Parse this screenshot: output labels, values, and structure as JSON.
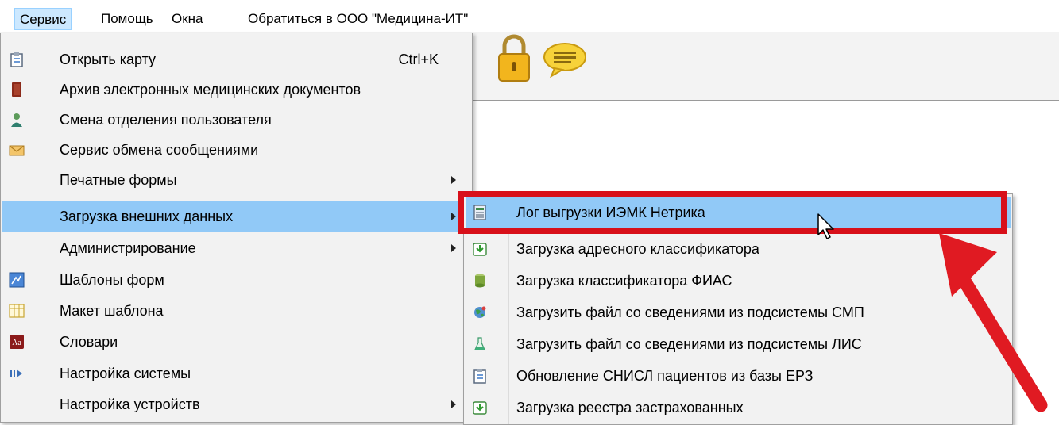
{
  "menubar": {
    "items": [
      "Сервис",
      "Помощь",
      "Окна",
      "Обратиться в ООО \"Медицина-ИТ\""
    ]
  },
  "service_menu": {
    "items": [
      {
        "label": "Открыть карту",
        "shortcut": "Ctrl+K",
        "icon": "clipboard-icon"
      },
      {
        "label": "Архив электронных медицинских документов",
        "icon": "archive-book-icon"
      },
      {
        "label": "Смена отделения пользователя",
        "icon": "doctor-icon"
      },
      {
        "label": "Сервис обмена сообщениями",
        "icon": "envelope-icon"
      },
      {
        "label": "Печатные формы",
        "submenu": true
      },
      {
        "label": "Загрузка внешних данных",
        "submenu": true,
        "highlighted": true
      },
      {
        "label": "Администрирование",
        "submenu": true
      },
      {
        "label": "Шаблоны форм",
        "icon": "template-icon"
      },
      {
        "label": "Макет шаблона",
        "icon": "grid-icon"
      },
      {
        "label": "Словари",
        "icon": "dictionary-icon"
      },
      {
        "label": "Настройка системы",
        "icon": "settings-arrow-icon"
      },
      {
        "label": "Настройка устройств",
        "submenu": true
      }
    ]
  },
  "external_data_menu": {
    "items": [
      {
        "label": "Лог выгрузки ИЭМК Нетрика",
        "icon": "log-list-icon",
        "highlighted": true
      },
      {
        "label": "Загрузка адресного классификатора",
        "icon": "download-green-icon"
      },
      {
        "label": "Загрузка классификатора ФИАС",
        "icon": "database-icon"
      },
      {
        "label": "Загрузить файл со сведениями из подсистемы СМП",
        "icon": "globe-icon"
      },
      {
        "label": "Загрузить файл со сведениями из подсистемы ЛИС",
        "icon": "flask-icon"
      },
      {
        "label": "Обновление СНИСЛ пациентов из базы ЕРЗ",
        "icon": "clipboard-icon"
      },
      {
        "label": "Загрузка реестра застрахованных",
        "icon": "download-green-icon"
      }
    ]
  },
  "colors": {
    "highlight": "#91c9f7",
    "annotation": "#d8101a",
    "menubar_active": "#cce8ff"
  }
}
